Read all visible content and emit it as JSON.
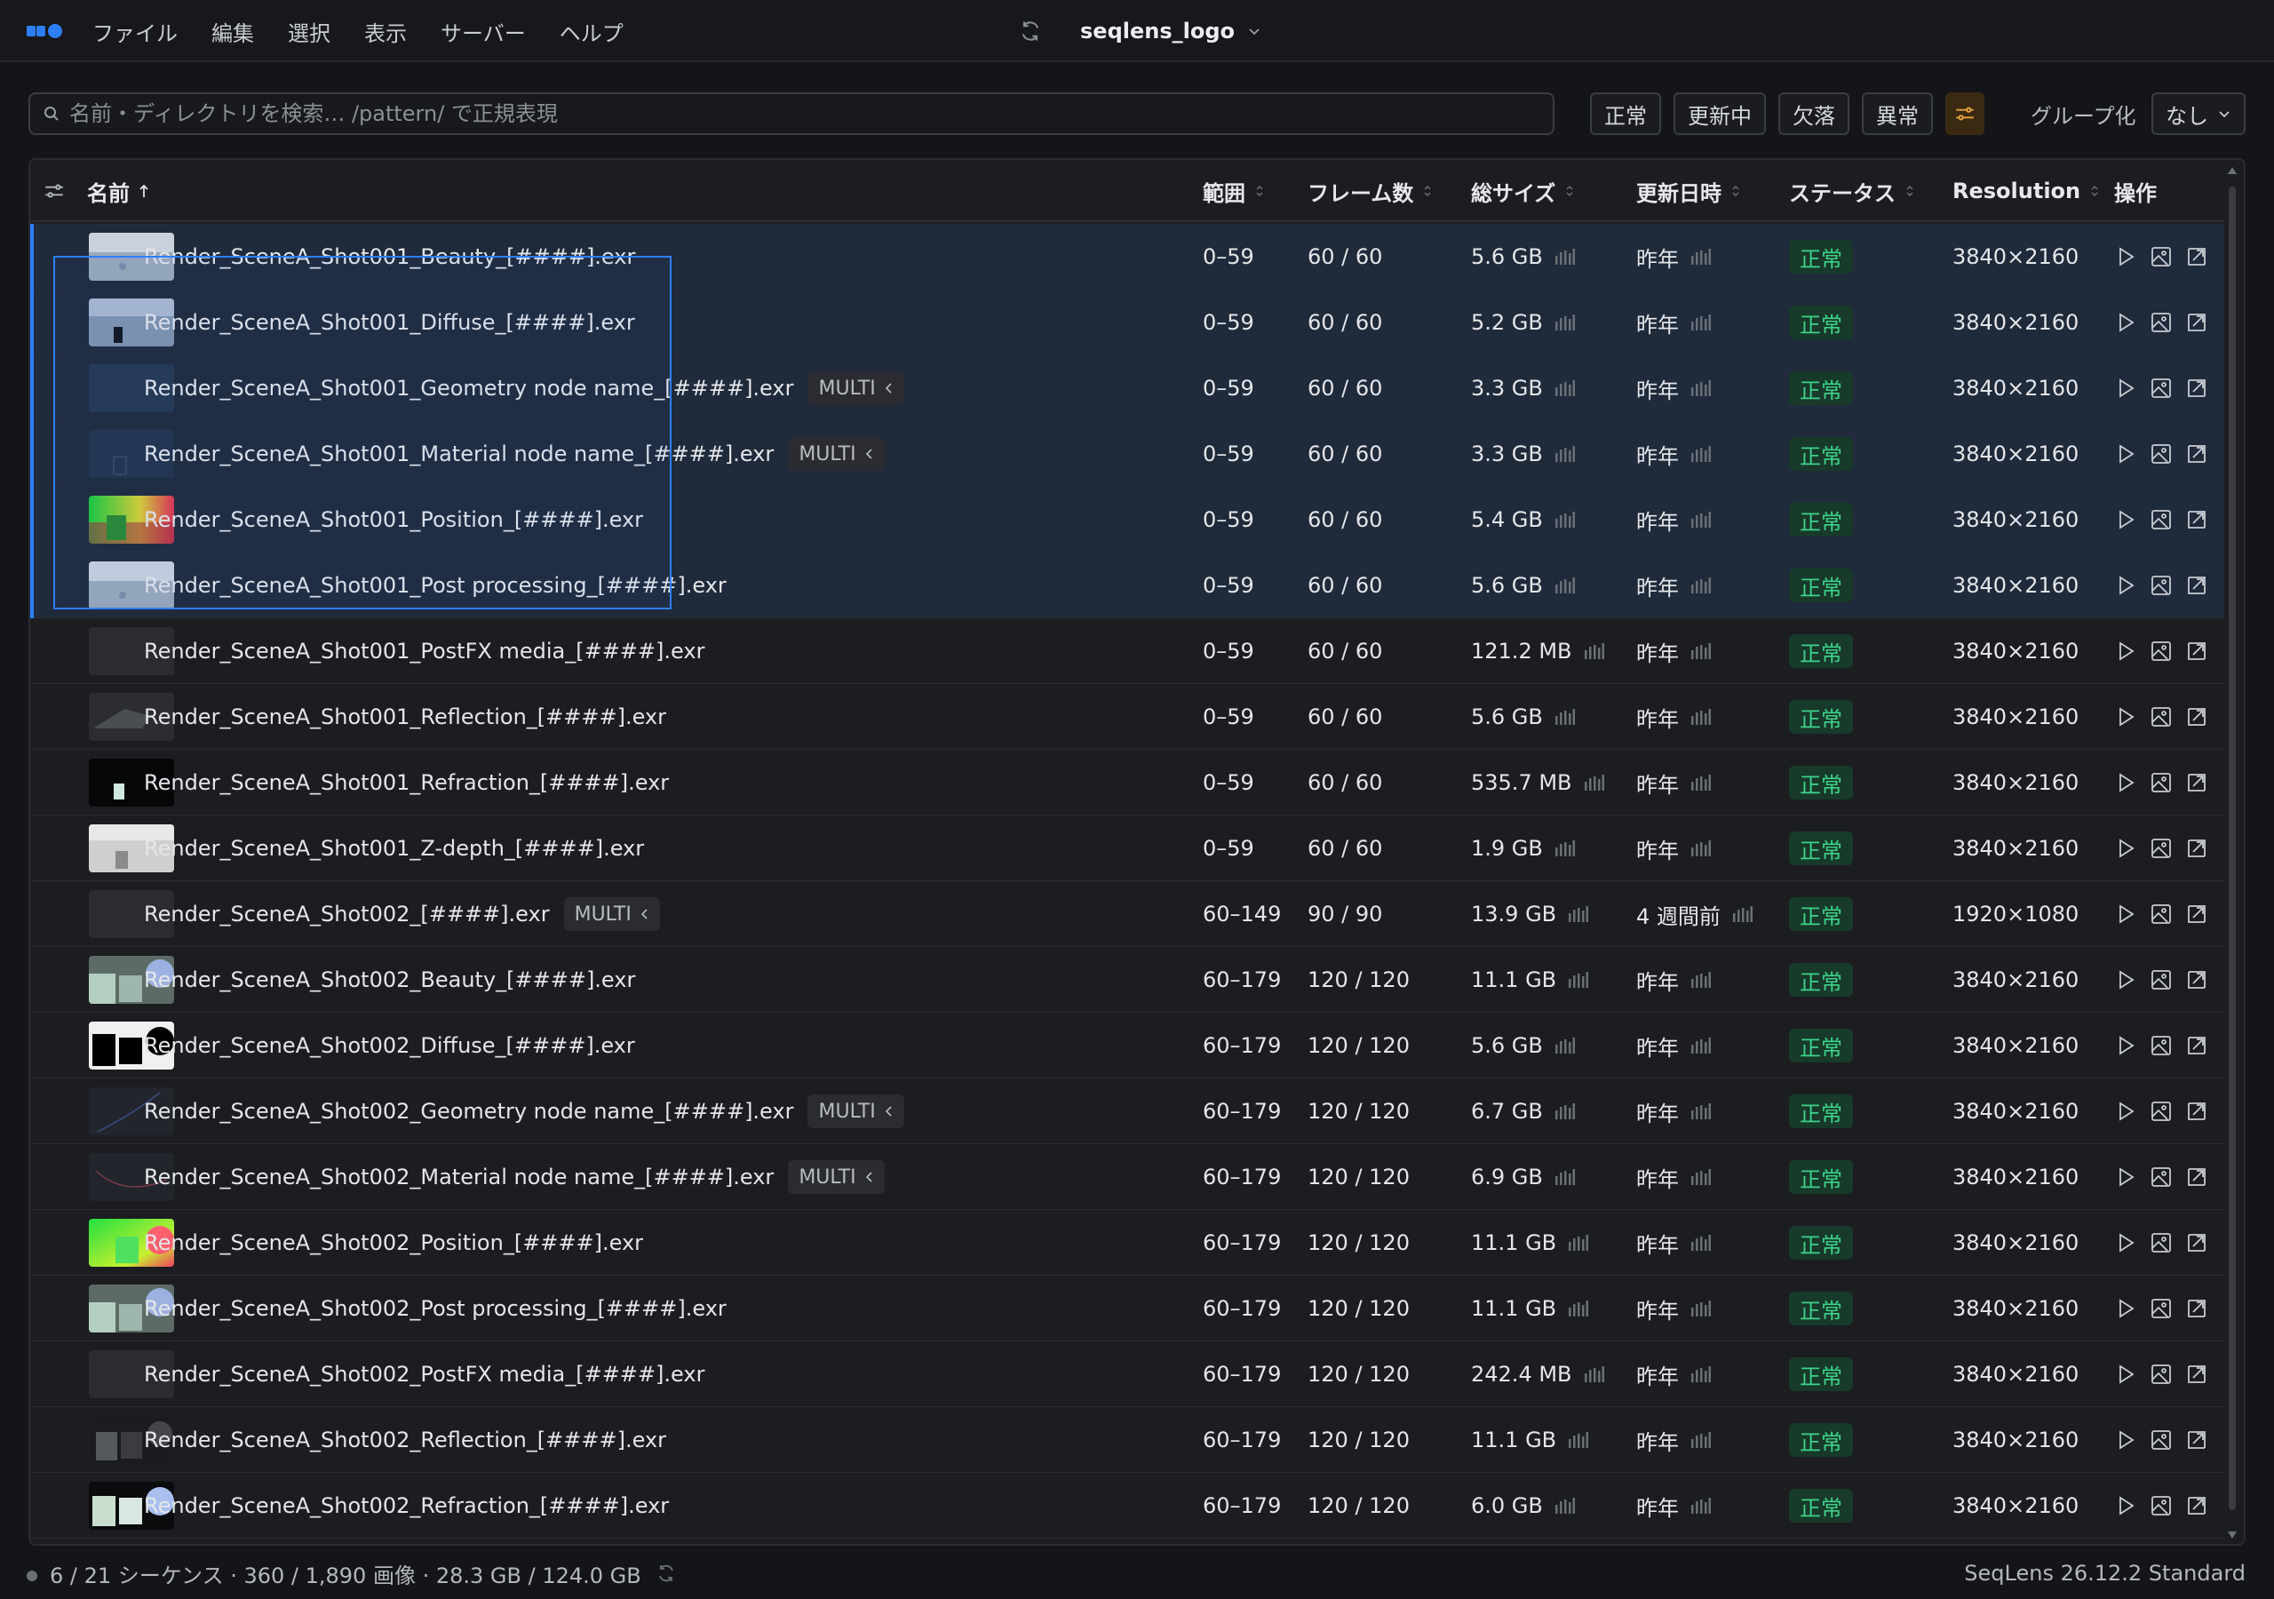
{
  "menu": [
    "ファイル",
    "編集",
    "選択",
    "表示",
    "サーバー",
    "ヘルプ"
  ],
  "project": {
    "name": "seqlens_logo"
  },
  "search": {
    "placeholder": "名前・ディレクトリを検索… /pattern/ で正規表現"
  },
  "filters": [
    "正常",
    "更新中",
    "欠落",
    "異常"
  ],
  "group": {
    "label": "グループ化",
    "value": "なし"
  },
  "columns": {
    "name": "名前",
    "range": "範囲",
    "frames": "フレーム数",
    "size": "総サイズ",
    "updated": "更新日時",
    "status": "ステータス",
    "resolution": "Resolution",
    "actions": "操作"
  },
  "multi_label": "MULTI",
  "rows": [
    {
      "name": "Render_SceneA_Shot001_Beauty_[####].exr",
      "multi": false,
      "range": "0–59",
      "frames": "60 / 60",
      "size": "5.6 GB",
      "updated": "昨年",
      "status": "正常",
      "resolution": "3840×2160",
      "selected": true,
      "thumb": "beauty1"
    },
    {
      "name": "Render_SceneA_Shot001_Diffuse_[####].exr",
      "multi": false,
      "range": "0–59",
      "frames": "60 / 60",
      "size": "5.2 GB",
      "updated": "昨年",
      "status": "正常",
      "resolution": "3840×2160",
      "selected": true,
      "thumb": "diffuse1"
    },
    {
      "name": "Render_SceneA_Shot001_Geometry node name_[####].exr",
      "multi": true,
      "range": "0–59",
      "frames": "60 / 60",
      "size": "3.3 GB",
      "updated": "昨年",
      "status": "正常",
      "resolution": "3840×2160",
      "selected": true,
      "thumb": "geo1"
    },
    {
      "name": "Render_SceneA_Shot001_Material node name_[####].exr",
      "multi": true,
      "range": "0–59",
      "frames": "60 / 60",
      "size": "3.3 GB",
      "updated": "昨年",
      "status": "正常",
      "resolution": "3840×2160",
      "selected": true,
      "thumb": "mat1"
    },
    {
      "name": "Render_SceneA_Shot001_Position_[####].exr",
      "multi": false,
      "range": "0–59",
      "frames": "60 / 60",
      "size": "5.4 GB",
      "updated": "昨年",
      "status": "正常",
      "resolution": "3840×2160",
      "selected": true,
      "thumb": "pos1"
    },
    {
      "name": "Render_SceneA_Shot001_Post processing_[####].exr",
      "multi": false,
      "range": "0–59",
      "frames": "60 / 60",
      "size": "5.6 GB",
      "updated": "昨年",
      "status": "正常",
      "resolution": "3840×2160",
      "selected": true,
      "thumb": "beauty1"
    },
    {
      "name": "Render_SceneA_Shot001_PostFX media_[####].exr",
      "multi": false,
      "range": "0–59",
      "frames": "60 / 60",
      "size": "121.2 MB",
      "updated": "昨年",
      "status": "正常",
      "resolution": "3840×2160",
      "selected": false,
      "thumb": "dark"
    },
    {
      "name": "Render_SceneA_Shot001_Reflection_[####].exr",
      "multi": false,
      "range": "0–59",
      "frames": "60 / 60",
      "size": "5.6 GB",
      "updated": "昨年",
      "status": "正常",
      "resolution": "3840×2160",
      "selected": false,
      "thumb": "refl1"
    },
    {
      "name": "Render_SceneA_Shot001_Refraction_[####].exr",
      "multi": false,
      "range": "0–59",
      "frames": "60 / 60",
      "size": "535.7 MB",
      "updated": "昨年",
      "status": "正常",
      "resolution": "3840×2160",
      "selected": false,
      "thumb": "refr1"
    },
    {
      "name": "Render_SceneA_Shot001_Z-depth_[####].exr",
      "multi": false,
      "range": "0–59",
      "frames": "60 / 60",
      "size": "1.9 GB",
      "updated": "昨年",
      "status": "正常",
      "resolution": "3840×2160",
      "selected": false,
      "thumb": "zdepth"
    },
    {
      "name": "Render_SceneA_Shot002_[####].exr",
      "multi": true,
      "range": "60–149",
      "frames": "90 / 90",
      "size": "13.9 GB",
      "updated": "4 週間前",
      "status": "正常",
      "resolution": "1920×1080",
      "selected": false,
      "thumb": "dark"
    },
    {
      "name": "Render_SceneA_Shot002_Beauty_[####].exr",
      "multi": false,
      "range": "60–179",
      "frames": "120 / 120",
      "size": "11.1 GB",
      "updated": "昨年",
      "status": "正常",
      "resolution": "3840×2160",
      "selected": false,
      "thumb": "beauty2"
    },
    {
      "name": "Render_SceneA_Shot002_Diffuse_[####].exr",
      "multi": false,
      "range": "60–179",
      "frames": "120 / 120",
      "size": "5.6 GB",
      "updated": "昨年",
      "status": "正常",
      "resolution": "3840×2160",
      "selected": false,
      "thumb": "diffuse2"
    },
    {
      "name": "Render_SceneA_Shot002_Geometry node name_[####].exr",
      "multi": true,
      "range": "60–179",
      "frames": "120 / 120",
      "size": "6.7 GB",
      "updated": "昨年",
      "status": "正常",
      "resolution": "3840×2160",
      "selected": false,
      "thumb": "geo2"
    },
    {
      "name": "Render_SceneA_Shot002_Material node name_[####].exr",
      "multi": true,
      "range": "60–179",
      "frames": "120 / 120",
      "size": "6.9 GB",
      "updated": "昨年",
      "status": "正常",
      "resolution": "3840×2160",
      "selected": false,
      "thumb": "mat2"
    },
    {
      "name": "Render_SceneA_Shot002_Position_[####].exr",
      "multi": false,
      "range": "60–179",
      "frames": "120 / 120",
      "size": "11.1 GB",
      "updated": "昨年",
      "status": "正常",
      "resolution": "3840×2160",
      "selected": false,
      "thumb": "pos2"
    },
    {
      "name": "Render_SceneA_Shot002_Post processing_[####].exr",
      "multi": false,
      "range": "60–179",
      "frames": "120 / 120",
      "size": "11.1 GB",
      "updated": "昨年",
      "status": "正常",
      "resolution": "3840×2160",
      "selected": false,
      "thumb": "beauty2"
    },
    {
      "name": "Render_SceneA_Shot002_PostFX media_[####].exr",
      "multi": false,
      "range": "60–179",
      "frames": "120 / 120",
      "size": "242.4 MB",
      "updated": "昨年",
      "status": "正常",
      "resolution": "3840×2160",
      "selected": false,
      "thumb": "dark"
    },
    {
      "name": "Render_SceneA_Shot002_Reflection_[####].exr",
      "multi": false,
      "range": "60–179",
      "frames": "120 / 120",
      "size": "11.1 GB",
      "updated": "昨年",
      "status": "正常",
      "resolution": "3840×2160",
      "selected": false,
      "thumb": "refl2"
    },
    {
      "name": "Render_SceneA_Shot002_Refraction_[####].exr",
      "multi": false,
      "range": "60–179",
      "frames": "120 / 120",
      "size": "6.0 GB",
      "updated": "昨年",
      "status": "正常",
      "resolution": "3840×2160",
      "selected": false,
      "thumb": "refr2"
    }
  ],
  "footer": {
    "summary": "6 / 21 シーケンス · 360 / 1,890 画像 · 28.3 GB / 124.0 GB",
    "version": "SeqLens 26.12.2 Standard"
  },
  "colors": {
    "accent": "#2d7ff9",
    "status_ok_text": "#3ed38a",
    "status_ok_bg": "#173a2a",
    "selected_row": "#1f2a3a"
  }
}
